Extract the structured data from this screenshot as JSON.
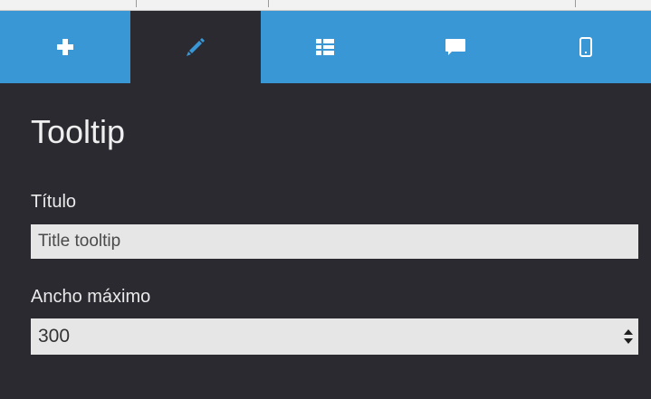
{
  "toolbar": {
    "tabs": [
      {
        "icon": "plus-icon",
        "active": false
      },
      {
        "icon": "pencil-icon",
        "active": true
      },
      {
        "icon": "list-icon",
        "active": false
      },
      {
        "icon": "comment-icon",
        "active": false
      },
      {
        "icon": "mobile-icon",
        "active": false
      }
    ],
    "colors": {
      "bar": "#3a97d6",
      "active_tab": "#2b2a30",
      "icon": "#ffffff"
    }
  },
  "panel": {
    "title": "Tooltip",
    "fields": {
      "title_label": "Título",
      "title_value": "Title tooltip",
      "width_label": "Ancho máximo",
      "width_value": "300"
    }
  }
}
